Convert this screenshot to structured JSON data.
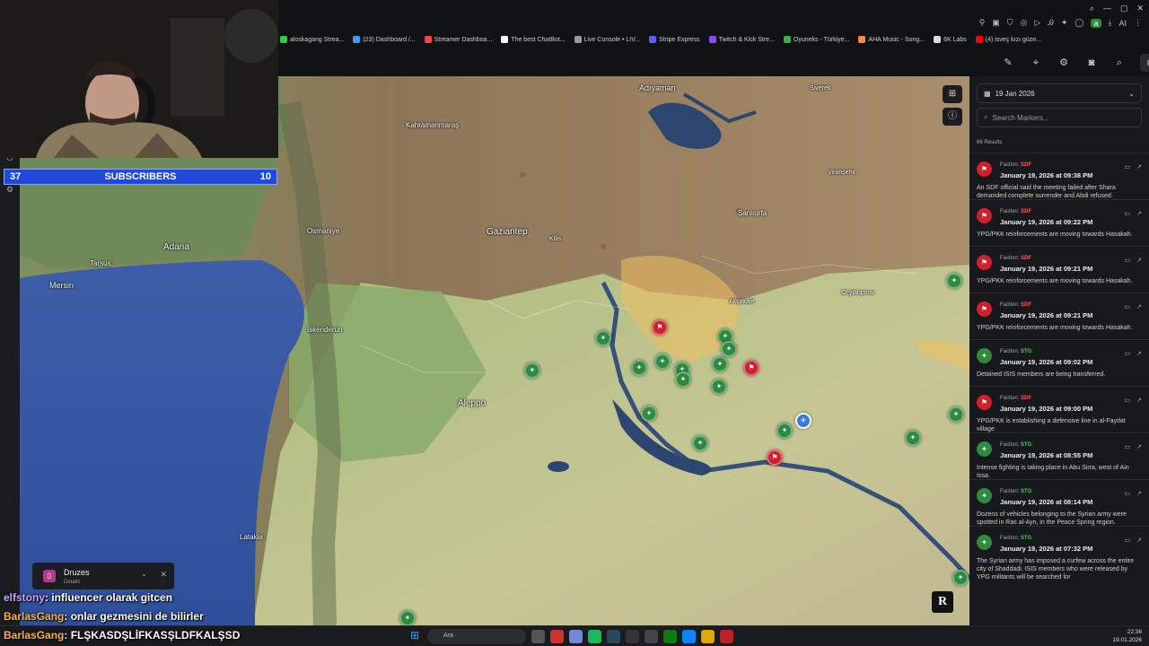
{
  "browser": {
    "bookmarks": [
      "aloskagang Strea...",
      "(23) Dashboard /...",
      "Streamer Dashboa...",
      "The best ChatBot...",
      "Live Console • LIV...",
      "Stripe Express",
      "Twitch & Kick Stre...",
      "Oyuneks - Türkiye...",
      "AHA Music - Song...",
      "6K Labs",
      "(4) isveç kızı güze..."
    ],
    "bookmark_colors": [
      "#2ecc40",
      "#3aa0ff",
      "#ff4444",
      "#ffffff",
      "#999999",
      "#635bff",
      "#9146ff",
      "#44aa44",
      "#ff8844",
      "#dddddd",
      "#ff0000"
    ],
    "ai_label": "AI"
  },
  "stream_overlay": {
    "subscribers_label": "SUBSCRIBERS",
    "sub_left": "37",
    "sub_right": "10",
    "chat": [
      {
        "user": "elfstony",
        "msg": ": influencer olarak gitcen"
      },
      {
        "user": "BarlasGang",
        "msg": ": onlar gezmesini de bilirler"
      },
      {
        "user": "BarlasGang",
        "msg": ": FLŞKASDŞLİFKASŞLDFKALŞSD"
      }
    ]
  },
  "map": {
    "labels": [
      {
        "text": "Adıyaman"
      },
      {
        "text": "Kahramanmaraş"
      },
      {
        "text": "Gaziantep"
      },
      {
        "text": "Şanlıurfa"
      },
      {
        "text": "Osmaniye"
      },
      {
        "text": "Adana"
      },
      {
        "text": "Tarsus"
      },
      {
        "text": "Mersin"
      },
      {
        "text": "İskenderun"
      },
      {
        "text": "Aleppo"
      },
      {
        "text": "Latakia"
      },
      {
        "text": "Kilis"
      },
      {
        "text": "Siverek"
      },
      {
        "text": "Viranşehir"
      },
      {
        "text": "Akçakale"
      },
      {
        "text": "Ceylanpınar"
      }
    ],
    "druzes_popup": {
      "title": "Druzes",
      "subtitle": "Details"
    },
    "r_button": "R"
  },
  "panel": {
    "date": "19 Jan 2026",
    "search_placeholder": "Search Markers...",
    "results": "66 Results",
    "items": [
      {
        "faction_label": "Faction:",
        "faction": "SDF",
        "color": "#d0202e",
        "time": "January 19, 2026 at 09:38 PM",
        "text": "An SDF official said the meeting failed after Shara demanded complete surrender and Abdi refused."
      },
      {
        "faction_label": "Faction:",
        "faction": "SDF",
        "color": "#d0202e",
        "time": "January 19, 2026 at 09:22 PM",
        "text": "YPG/PKK reinforcements are moving towards Hasakah."
      },
      {
        "faction_label": "Faction:",
        "faction": "SDF",
        "color": "#d0202e",
        "time": "January 19, 2026 at 09:21 PM",
        "text": "YPG/PKK reinforcements are moving towards Hasakah."
      },
      {
        "faction_label": "Faction:",
        "faction": "SDF",
        "color": "#d0202e",
        "time": "January 19, 2026 at 09:21 PM",
        "text": "YPG/PKK reinforcements are moving towards Hasakah."
      },
      {
        "faction_label": "Faction:",
        "faction": "STG",
        "color": "#2e8a3e",
        "time": "January 19, 2026 at 09:02 PM",
        "text": "Detained ISIS members are being transferred."
      },
      {
        "faction_label": "Faction:",
        "faction": "SDF",
        "color": "#d0202e",
        "time": "January 19, 2026 at 09:00 PM",
        "text": "YPG/PKK is establishing a defensive line in al-Faydat village"
      },
      {
        "faction_label": "Faction:",
        "faction": "STG",
        "color": "#2e8a3e",
        "time": "January 19, 2026 at 08:55 PM",
        "text": "Intense fighting is taking place in Abu Sirra, west of Ain Issa."
      },
      {
        "faction_label": "Faction:",
        "faction": "STG",
        "color": "#2e8a3e",
        "time": "January 19, 2026 at 08:14 PM",
        "text": "Dozens of vehicles belonging to the Syrian army were spotted in Ras al-Ayn, in the Peace Spring region."
      },
      {
        "faction_label": "Faction:",
        "faction": "STG",
        "color": "#2e8a3e",
        "time": "January 19, 2026 at 07:32 PM",
        "text": "The Syrian army has imposed a curfew across the entire city of Shaddadi. ISIS members who were released by YPG militants will be searched for"
      }
    ]
  },
  "taskbar": {
    "search": "Ara",
    "time": "22:38",
    "date": "19.01.2026"
  }
}
